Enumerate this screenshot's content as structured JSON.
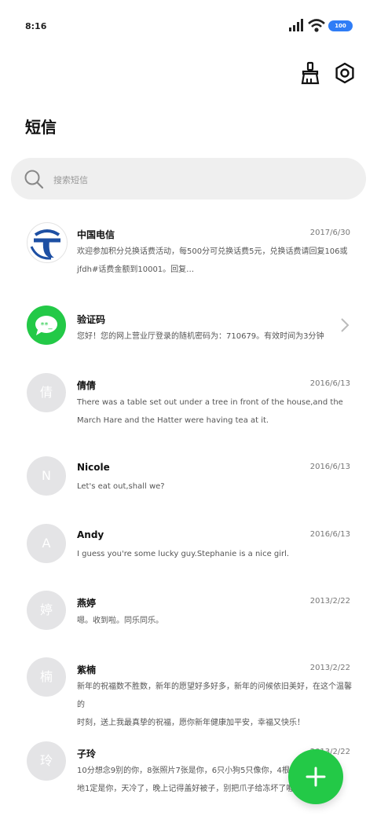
{
  "status_bar": {
    "time": "8:16",
    "battery": "100",
    "battery_color": "#2f7df6"
  },
  "toolbar": {
    "clean_icon": "broom-icon",
    "settings_icon": "settings-icon"
  },
  "page": {
    "title": "短信"
  },
  "search": {
    "placeholder": "搜索短信",
    "icon": "search-icon"
  },
  "conversations": [
    {
      "name": "中国电信",
      "date": "2017/6/30",
      "line1": "欢迎参加积分兑换话费活动，每500分可兑换话费5元，兑换话费请回复106或",
      "line2": "jfdh#话费金额到10001。回复…",
      "avatar": "china-telecom-logo"
    },
    {
      "name": "验证码",
      "date": "",
      "line1": "您好！您的网上营业厅登录的随机密码为：710679。有效时间为3分钟",
      "line2": "",
      "avatar": "verification-code-icon"
    },
    {
      "name": "倩倩",
      "date": "2016/6/13",
      "line1": "There was a table set out under a tree in front of the house,and the",
      "line2": "March Hare and the Hatter were having tea at it.",
      "avatar": "倩"
    },
    {
      "name": "Nicole",
      "date": "2016/6/13",
      "line1": "Let's eat out,shall we?",
      "line2": "",
      "avatar": "N"
    },
    {
      "name": "Andy",
      "date": "2016/6/13",
      "line1": "I guess you're some lucky guy.Stephanie is a nice girl.",
      "line2": "",
      "avatar": "A"
    },
    {
      "name": "燕婷",
      "date": "2013/2/22",
      "line1": "嗯。收到啦。同乐同乐。",
      "line2": "",
      "avatar": "婷"
    },
    {
      "name": "紫楠",
      "date": "2013/2/22",
      "line1": "新年的祝福数不胜数，新年的愿望好多好多，新年的问候依旧美好，在这个温馨的",
      "line2": "时刻，送上我最真挚的祝福，愿你新年健康加平安，幸福又快乐！",
      "avatar": "楠"
    },
    {
      "name": "子玲",
      "date": "2013/2/22",
      "line1": "10分想念9别的你，8张照片7张是你，6只小狗5只像你，4根骨头",
      "line2": "地1定是你，天冷了，晚上记得盖好被子，别把爪子给冻坏了喔！",
      "avatar": "玲"
    }
  ],
  "fab": {
    "icon": "plus-icon",
    "color": "#23c947"
  }
}
